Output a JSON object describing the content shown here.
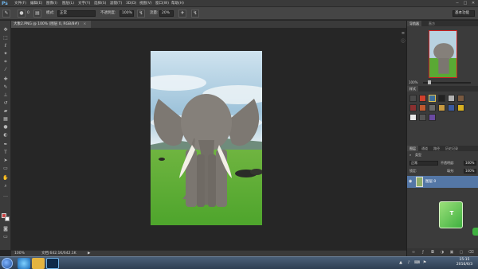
{
  "app": {
    "logo": "Ps"
  },
  "menu": [
    "文件(F)",
    "编辑(E)",
    "图像(I)",
    "图层(L)",
    "文字(Y)",
    "选择(S)",
    "滤镜(T)",
    "3D(D)",
    "视图(V)",
    "窗口(W)",
    "帮助(H)"
  ],
  "window_buttons": {
    "minimize": "─",
    "maximize": "□",
    "close": "✕"
  },
  "options": {
    "brush_size": "0",
    "mode_label": "模式:",
    "mode_value": "正常",
    "opacity_label": "不透明度:",
    "opacity_value": "100%",
    "flow_label": "流量:",
    "flow_value": "20%",
    "workspace": "基本功能"
  },
  "document": {
    "tab_title": "大象2.PNG @ 100% (图层 0, RGB/8#)",
    "tab_close": "×",
    "zoom": "100%",
    "doc_info": "文档:642.1K/642.1K",
    "status_arrow": "▶"
  },
  "panels": {
    "navigator_tabs": [
      "导航器",
      "直方"
    ],
    "navigator_zoom": "100%",
    "styles_tab": "样式",
    "layers_tabs": [
      "图层",
      "通道",
      "路径",
      "历史记录"
    ],
    "kind_label": "类型",
    "blend_mode": "正常",
    "opacity_label": "不透明度:",
    "opacity_value": "100%",
    "lock_label": "锁定:",
    "fill_label": "填充:",
    "fill_value": "100%",
    "layer_name": "图层 0",
    "eye": "◉"
  },
  "float_widget": {
    "text": "T"
  },
  "taskbar": {
    "time": "15:15",
    "date": "2016/6/3"
  },
  "colors": {
    "accent_layer_selected": "#5477a6",
    "foreground": "#c44444",
    "background": "#ffffff"
  },
  "icons": {
    "tools": [
      "move-icon",
      "marquee-icon",
      "lasso-icon",
      "quick-select-icon",
      "crop-icon",
      "eyedropper-icon",
      "healing-icon",
      "brush-icon",
      "stamp-icon",
      "history-brush-icon",
      "eraser-icon",
      "gradient-icon",
      "blur-icon",
      "dodge-icon",
      "pen-icon",
      "type-icon",
      "path-select-icon",
      "shape-icon",
      "hand-icon",
      "zoom-icon"
    ]
  }
}
